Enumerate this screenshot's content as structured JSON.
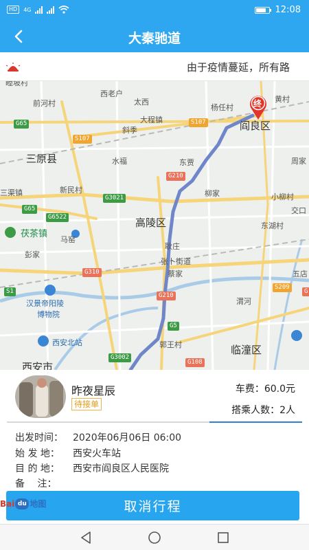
{
  "status_bar": {
    "hd": "HD",
    "network": "4G",
    "time": "12:08"
  },
  "header": {
    "title": "大秦驰道"
  },
  "notice": {
    "text": "由于疫情蔓延，所有路"
  },
  "map": {
    "places": {
      "p1": "西老户",
      "p2": "前河村",
      "p3": "太西",
      "p4": "大程镇",
      "p5": "杨任村",
      "p6": "黄村",
      "p7": "阎良区",
      "p8": "斜季",
      "p9": "三原县",
      "p10": "水福",
      "p11": "东贾",
      "p12": "周家",
      "p13": "三渠镇",
      "p14": "新民村",
      "p15": "柳家",
      "p16": "小柳村",
      "p17": "交口",
      "p18": "高陵区",
      "p19": "东湖村",
      "p20": "茯茶镇",
      "p21": "马窑",
      "p22": "彭家",
      "p23": "耿庄",
      "p24": "张卜街道",
      "p25": "五店",
      "p26": "蔡家",
      "p27": "渭河",
      "p28": "汉景帝阳陵",
      "p29": "博物院",
      "p30": "西安北站",
      "p31": "郭王村",
      "p32": "临潼区",
      "p33": "西安市",
      "p34": "睦坡村"
    },
    "shields": {
      "s1": "G65",
      "s2": "S107",
      "s3": "S107",
      "s4": "G210",
      "s5": "G3021",
      "s6": "G65",
      "s7": "G6522",
      "s8": "G310",
      "s9": "S1",
      "s10": "G210",
      "s11": "S209",
      "s12": "G5",
      "s13": "G3002",
      "s14": "G108",
      "s15": "G"
    },
    "end_marker": "终"
  },
  "trip": {
    "driver_name": "昨夜星辰",
    "status_badge": "待接单",
    "fee_label": "车费：",
    "fee_value": "60.0元",
    "seats_label": "搭乘人数：",
    "seats_value": "2人",
    "departure_label": "出发时间：",
    "departure_value": "2020年06月06日 06:00",
    "origin_label": "始 发 地：",
    "origin_value": "西安火车站",
    "destination_label": "目 的 地：",
    "destination_value": "西安市阎良区人民医院",
    "remark_label": "备　 注：",
    "remark_value": "",
    "cancel_label": "取消行程"
  },
  "map_logo": {
    "brand": "Bai",
    "paw": "du",
    "suffix": "地图"
  },
  "colors": {
    "primary": "#2ea7f0",
    "badge": "#e79d18",
    "route": "#6f86c9"
  }
}
